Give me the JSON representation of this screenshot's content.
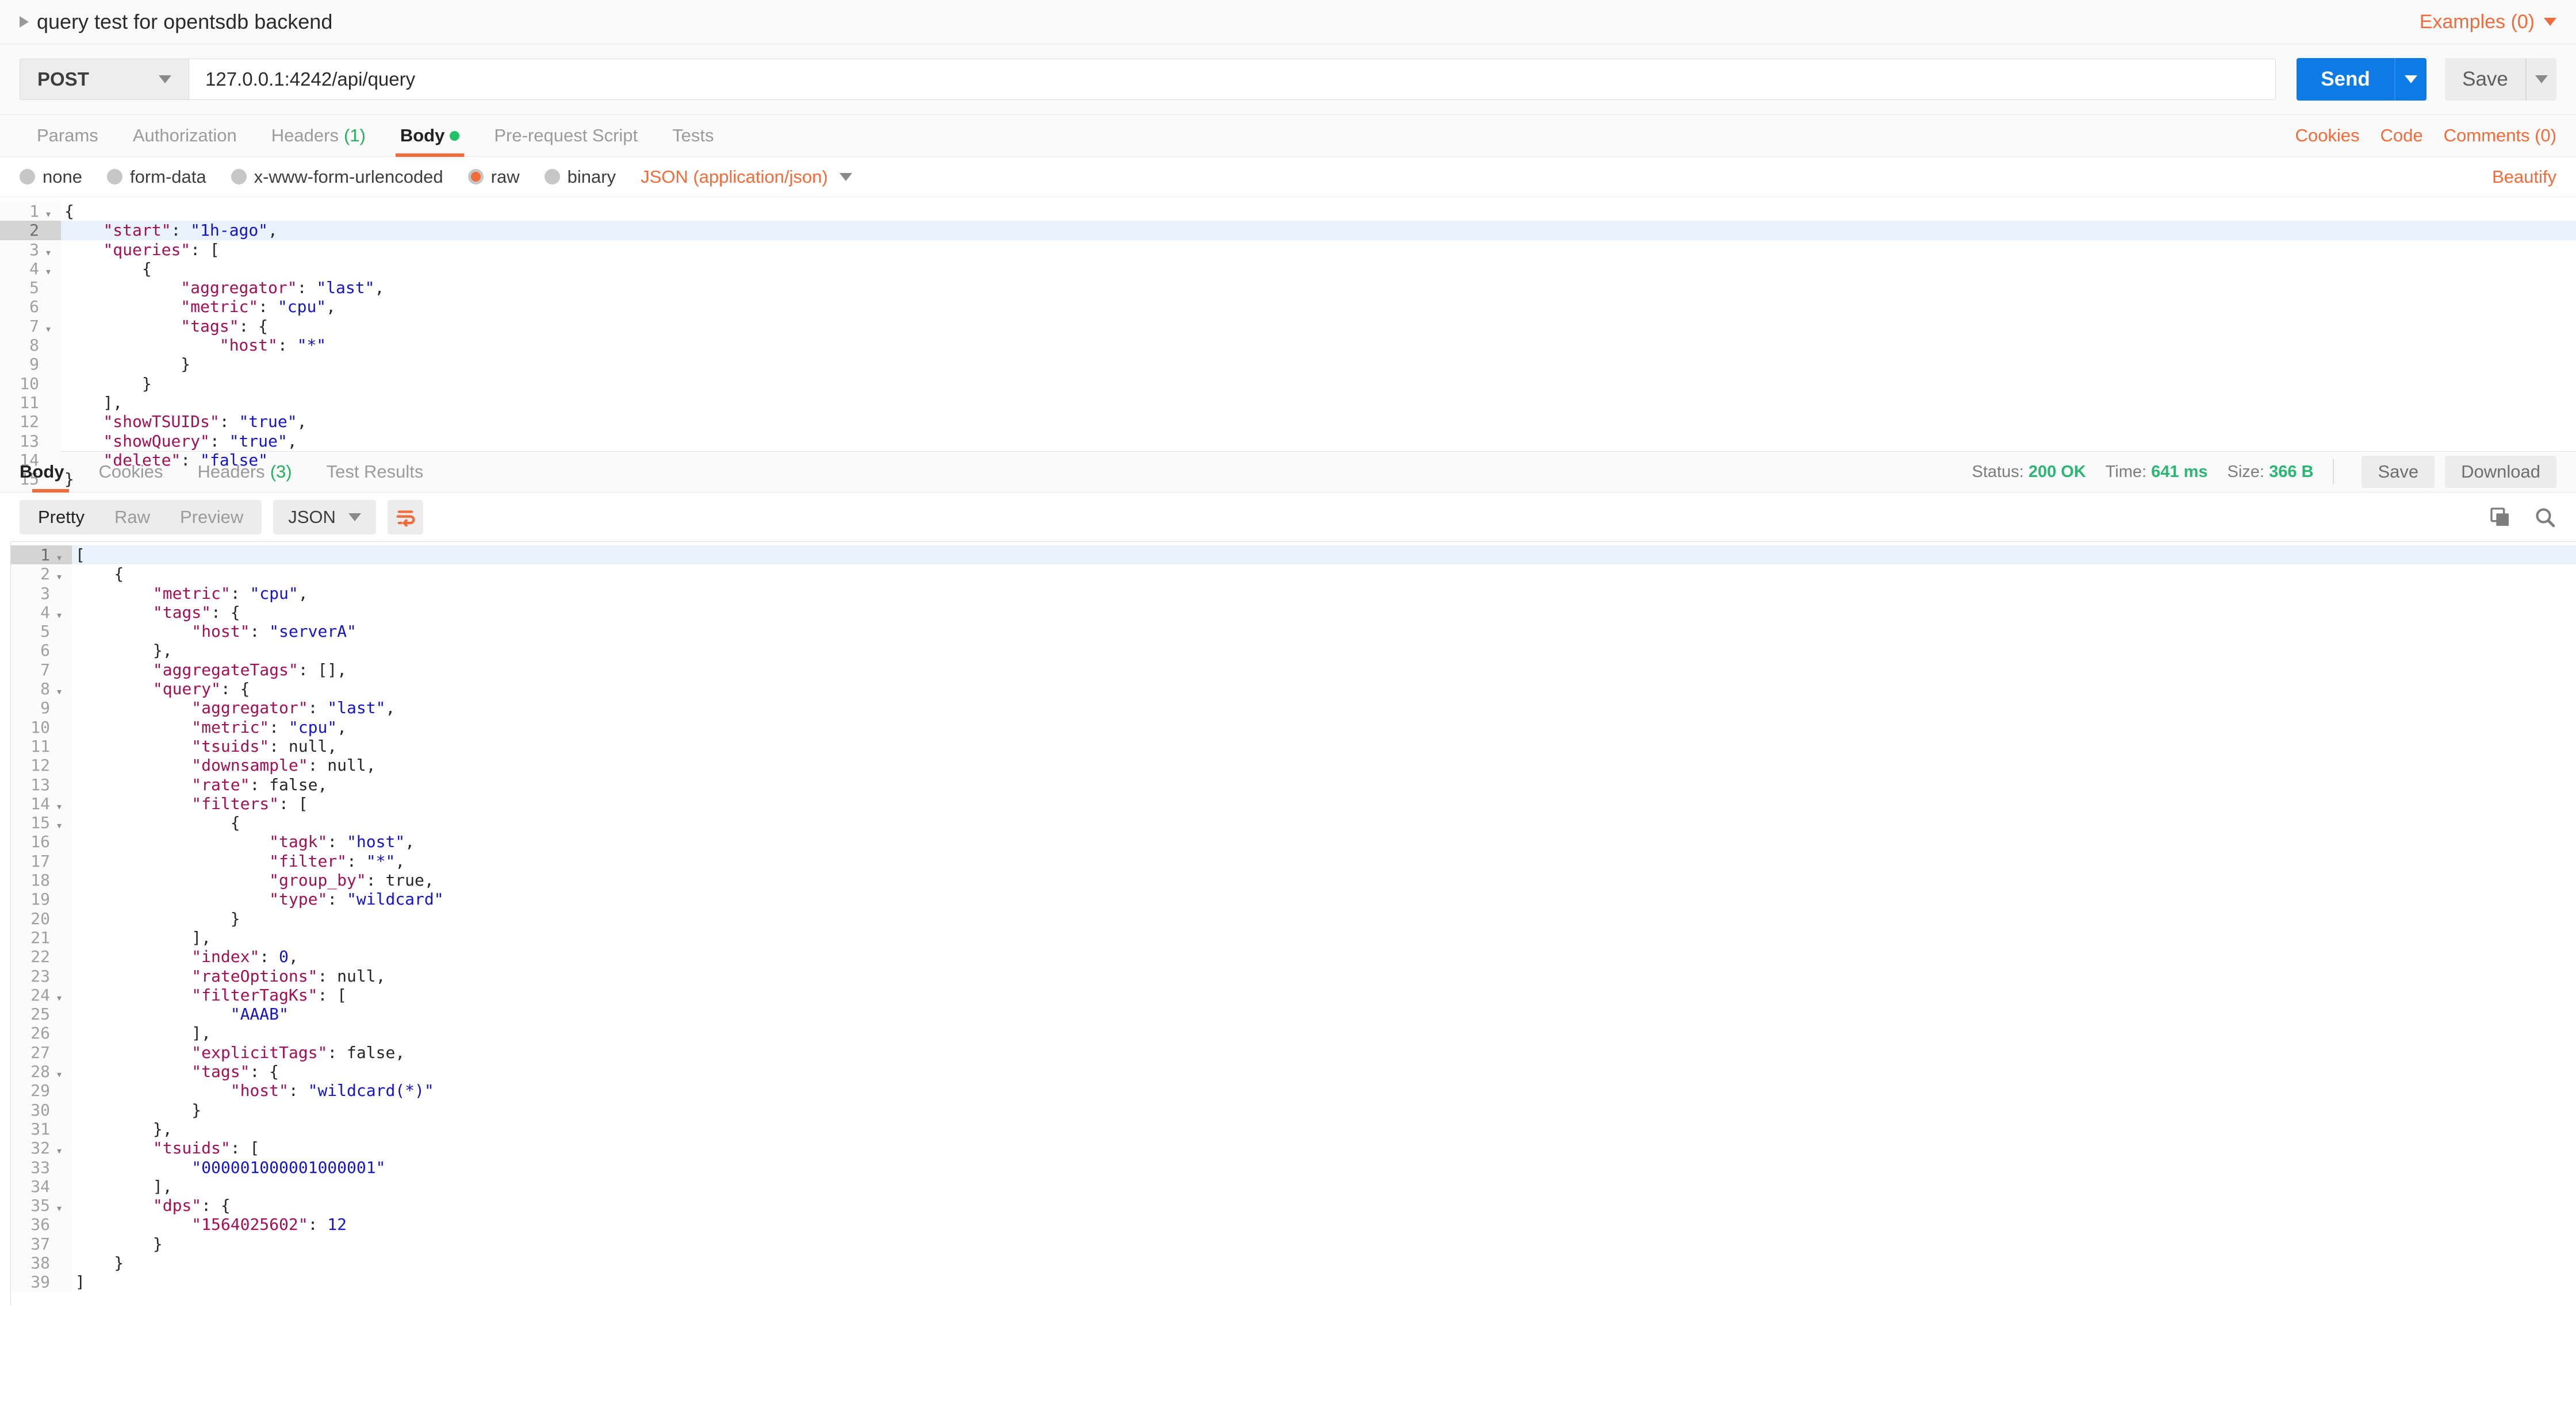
{
  "request": {
    "title": "query test for opentsdb backend",
    "examples_label": "Examples (0)",
    "method": "POST",
    "url": "127.0.0.1:4242/api/query",
    "send_label": "Send",
    "save_label": "Save",
    "tabs": [
      {
        "label": "Params",
        "count": "",
        "active": false,
        "dot": false
      },
      {
        "label": "Authorization",
        "count": "",
        "active": false,
        "dot": false
      },
      {
        "label": "Headers",
        "count": "(1)",
        "active": false,
        "dot": false
      },
      {
        "label": "Body",
        "count": "",
        "active": true,
        "dot": true
      },
      {
        "label": "Pre-request Script",
        "count": "",
        "active": false,
        "dot": false
      },
      {
        "label": "Tests",
        "count": "",
        "active": false,
        "dot": false
      }
    ],
    "links": [
      "Cookies",
      "Code",
      "Comments (0)"
    ],
    "body_types": [
      {
        "label": "none",
        "selected": false
      },
      {
        "label": "form-data",
        "selected": false
      },
      {
        "label": "x-www-form-urlencoded",
        "selected": false
      },
      {
        "label": "raw",
        "selected": true
      },
      {
        "label": "binary",
        "selected": false
      }
    ],
    "content_type": "JSON (application/json)",
    "beautify_label": "Beautify",
    "body_lines": [
      {
        "n": 1,
        "fold": true,
        "active": false,
        "tokens": [
          [
            "p",
            "{"
          ]
        ]
      },
      {
        "n": 2,
        "fold": false,
        "active": true,
        "tokens": [
          [
            "p",
            "    "
          ],
          [
            "k",
            "\"start\""
          ],
          [
            "p",
            ": "
          ],
          [
            "s",
            "\"1h-ago\""
          ],
          [
            "p",
            ","
          ]
        ]
      },
      {
        "n": 3,
        "fold": true,
        "active": false,
        "tokens": [
          [
            "p",
            "    "
          ],
          [
            "k",
            "\"queries\""
          ],
          [
            "p",
            ": ["
          ]
        ]
      },
      {
        "n": 4,
        "fold": true,
        "active": false,
        "tokens": [
          [
            "p",
            "        {"
          ]
        ]
      },
      {
        "n": 5,
        "fold": false,
        "active": false,
        "tokens": [
          [
            "p",
            "            "
          ],
          [
            "k",
            "\"aggregator\""
          ],
          [
            "p",
            ": "
          ],
          [
            "s",
            "\"last\""
          ],
          [
            "p",
            ","
          ]
        ]
      },
      {
        "n": 6,
        "fold": false,
        "active": false,
        "tokens": [
          [
            "p",
            "            "
          ],
          [
            "k",
            "\"metric\""
          ],
          [
            "p",
            ": "
          ],
          [
            "s",
            "\"cpu\""
          ],
          [
            "p",
            ","
          ]
        ]
      },
      {
        "n": 7,
        "fold": true,
        "active": false,
        "tokens": [
          [
            "p",
            "            "
          ],
          [
            "k",
            "\"tags\""
          ],
          [
            "p",
            ": {"
          ]
        ]
      },
      {
        "n": 8,
        "fold": false,
        "active": false,
        "tokens": [
          [
            "p",
            "                "
          ],
          [
            "k",
            "\"host\""
          ],
          [
            "p",
            ": "
          ],
          [
            "s",
            "\"*\""
          ]
        ]
      },
      {
        "n": 9,
        "fold": false,
        "active": false,
        "tokens": [
          [
            "p",
            "            }"
          ]
        ]
      },
      {
        "n": 10,
        "fold": false,
        "active": false,
        "tokens": [
          [
            "p",
            "        }"
          ]
        ]
      },
      {
        "n": 11,
        "fold": false,
        "active": false,
        "tokens": [
          [
            "p",
            "    ],"
          ]
        ]
      },
      {
        "n": 12,
        "fold": false,
        "active": false,
        "tokens": [
          [
            "p",
            "    "
          ],
          [
            "k",
            "\"showTSUIDs\""
          ],
          [
            "p",
            ": "
          ],
          [
            "s",
            "\"true\""
          ],
          [
            "p",
            ","
          ]
        ]
      },
      {
        "n": 13,
        "fold": false,
        "active": false,
        "tokens": [
          [
            "p",
            "    "
          ],
          [
            "k",
            "\"showQuery\""
          ],
          [
            "p",
            ": "
          ],
          [
            "s",
            "\"true\""
          ],
          [
            "p",
            ","
          ]
        ]
      },
      {
        "n": 14,
        "fold": false,
        "active": false,
        "tokens": [
          [
            "p",
            "    "
          ],
          [
            "k",
            "\"delete\""
          ],
          [
            "p",
            ": "
          ],
          [
            "s",
            "\"false\""
          ]
        ]
      },
      {
        "n": 15,
        "fold": false,
        "active": false,
        "tokens": [
          [
            "p",
            "}"
          ]
        ]
      }
    ]
  },
  "response": {
    "tabs": [
      {
        "label": "Body",
        "count": "",
        "active": true
      },
      {
        "label": "Cookies",
        "count": "",
        "active": false
      },
      {
        "label": "Headers",
        "count": "(3)",
        "active": false
      },
      {
        "label": "Test Results",
        "count": "",
        "active": false
      }
    ],
    "status_label": "Status:",
    "status_value": "200 OK",
    "time_label": "Time:",
    "time_value": "641 ms",
    "size_label": "Size:",
    "size_value": "366 B",
    "save_label": "Save",
    "download_label": "Download",
    "view_modes": [
      {
        "label": "Pretty",
        "active": true
      },
      {
        "label": "Raw",
        "active": false
      },
      {
        "label": "Preview",
        "active": false
      }
    ],
    "format": "JSON",
    "body_lines": [
      {
        "n": 1,
        "fold": true,
        "active": true,
        "tokens": [
          [
            "p",
            "["
          ]
        ]
      },
      {
        "n": 2,
        "fold": true,
        "active": false,
        "tokens": [
          [
            "p",
            "    {"
          ]
        ]
      },
      {
        "n": 3,
        "fold": false,
        "active": false,
        "tokens": [
          [
            "p",
            "        "
          ],
          [
            "k",
            "\"metric\""
          ],
          [
            "p",
            ": "
          ],
          [
            "s",
            "\"cpu\""
          ],
          [
            "p",
            ","
          ]
        ]
      },
      {
        "n": 4,
        "fold": true,
        "active": false,
        "tokens": [
          [
            "p",
            "        "
          ],
          [
            "k",
            "\"tags\""
          ],
          [
            "p",
            ": {"
          ]
        ]
      },
      {
        "n": 5,
        "fold": false,
        "active": false,
        "tokens": [
          [
            "p",
            "            "
          ],
          [
            "k",
            "\"host\""
          ],
          [
            "p",
            ": "
          ],
          [
            "s",
            "\"serverA\""
          ]
        ]
      },
      {
        "n": 6,
        "fold": false,
        "active": false,
        "tokens": [
          [
            "p",
            "        },"
          ]
        ]
      },
      {
        "n": 7,
        "fold": false,
        "active": false,
        "tokens": [
          [
            "p",
            "        "
          ],
          [
            "k",
            "\"aggregateTags\""
          ],
          [
            "p",
            ": [],"
          ]
        ]
      },
      {
        "n": 8,
        "fold": true,
        "active": false,
        "tokens": [
          [
            "p",
            "        "
          ],
          [
            "k",
            "\"query\""
          ],
          [
            "p",
            ": {"
          ]
        ]
      },
      {
        "n": 9,
        "fold": false,
        "active": false,
        "tokens": [
          [
            "p",
            "            "
          ],
          [
            "k",
            "\"aggregator\""
          ],
          [
            "p",
            ": "
          ],
          [
            "s",
            "\"last\""
          ],
          [
            "p",
            ","
          ]
        ]
      },
      {
        "n": 10,
        "fold": false,
        "active": false,
        "tokens": [
          [
            "p",
            "            "
          ],
          [
            "k",
            "\"metric\""
          ],
          [
            "p",
            ": "
          ],
          [
            "s",
            "\"cpu\""
          ],
          [
            "p",
            ","
          ]
        ]
      },
      {
        "n": 11,
        "fold": false,
        "active": false,
        "tokens": [
          [
            "p",
            "            "
          ],
          [
            "k",
            "\"tsuids\""
          ],
          [
            "p",
            ": null,"
          ]
        ]
      },
      {
        "n": 12,
        "fold": false,
        "active": false,
        "tokens": [
          [
            "p",
            "            "
          ],
          [
            "k",
            "\"downsample\""
          ],
          [
            "p",
            ": null,"
          ]
        ]
      },
      {
        "n": 13,
        "fold": false,
        "active": false,
        "tokens": [
          [
            "p",
            "            "
          ],
          [
            "k",
            "\"rate\""
          ],
          [
            "p",
            ": false,"
          ]
        ]
      },
      {
        "n": 14,
        "fold": true,
        "active": false,
        "tokens": [
          [
            "p",
            "            "
          ],
          [
            "k",
            "\"filters\""
          ],
          [
            "p",
            ": ["
          ]
        ]
      },
      {
        "n": 15,
        "fold": true,
        "active": false,
        "tokens": [
          [
            "p",
            "                {"
          ]
        ]
      },
      {
        "n": 16,
        "fold": false,
        "active": false,
        "tokens": [
          [
            "p",
            "                    "
          ],
          [
            "k",
            "\"tagk\""
          ],
          [
            "p",
            ": "
          ],
          [
            "s",
            "\"host\""
          ],
          [
            "p",
            ","
          ]
        ]
      },
      {
        "n": 17,
        "fold": false,
        "active": false,
        "tokens": [
          [
            "p",
            "                    "
          ],
          [
            "k",
            "\"filter\""
          ],
          [
            "p",
            ": "
          ],
          [
            "s",
            "\"*\""
          ],
          [
            "p",
            ","
          ]
        ]
      },
      {
        "n": 18,
        "fold": false,
        "active": false,
        "tokens": [
          [
            "p",
            "                    "
          ],
          [
            "k",
            "\"group_by\""
          ],
          [
            "p",
            ": true,"
          ]
        ]
      },
      {
        "n": 19,
        "fold": false,
        "active": false,
        "tokens": [
          [
            "p",
            "                    "
          ],
          [
            "k",
            "\"type\""
          ],
          [
            "p",
            ": "
          ],
          [
            "s",
            "\"wildcard\""
          ]
        ]
      },
      {
        "n": 20,
        "fold": false,
        "active": false,
        "tokens": [
          [
            "p",
            "                }"
          ]
        ]
      },
      {
        "n": 21,
        "fold": false,
        "active": false,
        "tokens": [
          [
            "p",
            "            ],"
          ]
        ]
      },
      {
        "n": 22,
        "fold": false,
        "active": false,
        "tokens": [
          [
            "p",
            "            "
          ],
          [
            "k",
            "\"index\""
          ],
          [
            "p",
            ": "
          ],
          [
            "n",
            "0"
          ],
          [
            "p",
            ","
          ]
        ]
      },
      {
        "n": 23,
        "fold": false,
        "active": false,
        "tokens": [
          [
            "p",
            "            "
          ],
          [
            "k",
            "\"rateOptions\""
          ],
          [
            "p",
            ": null,"
          ]
        ]
      },
      {
        "n": 24,
        "fold": true,
        "active": false,
        "tokens": [
          [
            "p",
            "            "
          ],
          [
            "k",
            "\"filterTagKs\""
          ],
          [
            "p",
            ": ["
          ]
        ]
      },
      {
        "n": 25,
        "fold": false,
        "active": false,
        "tokens": [
          [
            "p",
            "                "
          ],
          [
            "s",
            "\"AAAB\""
          ]
        ]
      },
      {
        "n": 26,
        "fold": false,
        "active": false,
        "tokens": [
          [
            "p",
            "            ],"
          ]
        ]
      },
      {
        "n": 27,
        "fold": false,
        "active": false,
        "tokens": [
          [
            "p",
            "            "
          ],
          [
            "k",
            "\"explicitTags\""
          ],
          [
            "p",
            ": false,"
          ]
        ]
      },
      {
        "n": 28,
        "fold": true,
        "active": false,
        "tokens": [
          [
            "p",
            "            "
          ],
          [
            "k",
            "\"tags\""
          ],
          [
            "p",
            ": {"
          ]
        ]
      },
      {
        "n": 29,
        "fold": false,
        "active": false,
        "tokens": [
          [
            "p",
            "                "
          ],
          [
            "k",
            "\"host\""
          ],
          [
            "p",
            ": "
          ],
          [
            "s",
            "\"wildcard(*)\""
          ]
        ]
      },
      {
        "n": 30,
        "fold": false,
        "active": false,
        "tokens": [
          [
            "p",
            "            }"
          ]
        ]
      },
      {
        "n": 31,
        "fold": false,
        "active": false,
        "tokens": [
          [
            "p",
            "        },"
          ]
        ]
      },
      {
        "n": 32,
        "fold": true,
        "active": false,
        "tokens": [
          [
            "p",
            "        "
          ],
          [
            "k",
            "\"tsuids\""
          ],
          [
            "p",
            ": ["
          ]
        ]
      },
      {
        "n": 33,
        "fold": false,
        "active": false,
        "tokens": [
          [
            "p",
            "            "
          ],
          [
            "s",
            "\"000001000001000001\""
          ]
        ]
      },
      {
        "n": 34,
        "fold": false,
        "active": false,
        "tokens": [
          [
            "p",
            "        ],"
          ]
        ]
      },
      {
        "n": 35,
        "fold": true,
        "active": false,
        "tokens": [
          [
            "p",
            "        "
          ],
          [
            "k",
            "\"dps\""
          ],
          [
            "p",
            ": {"
          ]
        ]
      },
      {
        "n": 36,
        "fold": false,
        "active": false,
        "tokens": [
          [
            "p",
            "            "
          ],
          [
            "k",
            "\"1564025602\""
          ],
          [
            "p",
            ": "
          ],
          [
            "n",
            "12"
          ]
        ]
      },
      {
        "n": 37,
        "fold": false,
        "active": false,
        "tokens": [
          [
            "p",
            "        }"
          ]
        ]
      },
      {
        "n": 38,
        "fold": false,
        "active": false,
        "tokens": [
          [
            "p",
            "    }"
          ]
        ]
      },
      {
        "n": 39,
        "fold": false,
        "active": false,
        "tokens": [
          [
            "p",
            "]"
          ]
        ]
      }
    ]
  },
  "icons": {
    "collapse": "caret-right-icon",
    "copy": "copy-icon",
    "search": "search-icon",
    "wrap": "word-wrap-icon"
  },
  "colors": {
    "accent": "#f26b3a",
    "send": "#0d7ae5",
    "success": "#2bb673",
    "key": "#a11054",
    "string": "#1414c8"
  }
}
